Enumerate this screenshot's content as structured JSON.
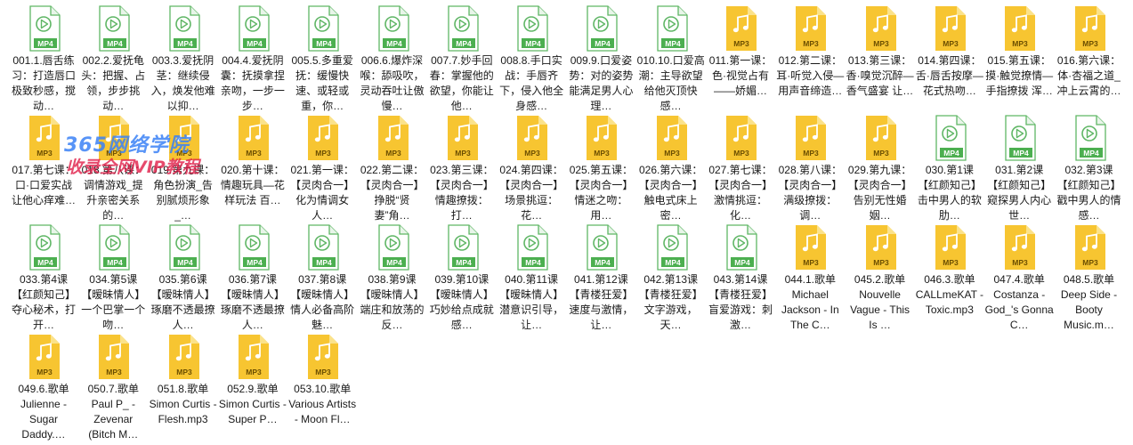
{
  "icons": {
    "mp4_label": "MP4",
    "mp3_label": "MP3",
    "mp4_color": "#4caf50",
    "mp3_color": "#f7c531"
  },
  "watermark": {
    "line1": "365网络学院",
    "line2": "收录全网VIP教程"
  },
  "files": [
    {
      "type": "mp4",
      "name": "001.1.唇舌练习：打造唇口极致秒感，搅动…"
    },
    {
      "type": "mp4",
      "name": "002.2.爱抚龟头：把握、占领，步步挑动…"
    },
    {
      "type": "mp4",
      "name": "003.3.爱抚阴茎：继续侵入，焕发他难以抑…"
    },
    {
      "type": "mp4",
      "name": "004.4.爱抚阴囊：抚摸拿捏亲吻，一步一步…"
    },
    {
      "type": "mp4",
      "name": "005.5.多重爱抚：缓慢快速、或轻或重，你…"
    },
    {
      "type": "mp4",
      "name": "006.6.爆炸深喉：舔吸吹，灵动吞吐让傲慢…"
    },
    {
      "type": "mp4",
      "name": "007.7.妙手回春：掌握他的欲望，你能让他…"
    },
    {
      "type": "mp4",
      "name": "008.8.手口实战：手唇齐下，侵入他全身感…"
    },
    {
      "type": "mp4",
      "name": "009.9.口爱姿势：对的姿势能满足男人心理…"
    },
    {
      "type": "mp4",
      "name": "010.10.口爱高潮：主导欲望给他灭顶快感…"
    },
    {
      "type": "mp3",
      "name": "011.第一课：色·视觉占有——娇媚…"
    },
    {
      "type": "mp3",
      "name": "012.第二课：耳·听觉入侵—用声音缔造…"
    },
    {
      "type": "mp3",
      "name": "013.第三课：香·嗅觉沉醉—香气盛宴 让…"
    },
    {
      "type": "mp3",
      "name": "014.第四课：舌·唇舌按摩—花式热吻…"
    },
    {
      "type": "mp3",
      "name": "015.第五课：摸·触觉撩情—手指撩拨 浑…"
    },
    {
      "type": "mp3",
      "name": "016.第六课：体·杏福之道_冲上云霄的…"
    },
    {
      "type": "mp3",
      "name": "017.第七课：口·口爱实战 让他心痒难…"
    },
    {
      "type": "mp3",
      "name": "018.第八课：调情游戏_提升亲密关系的…"
    },
    {
      "type": "mp3",
      "name": "019.第九课：角色扮演_告别腻烦形象_…"
    },
    {
      "type": "mp3",
      "name": "020.第十课：情趣玩具—花样玩法 百…"
    },
    {
      "type": "mp3",
      "name": "021.第一课：【灵肉合一】化为情调女人…"
    },
    {
      "type": "mp3",
      "name": "022.第二课：【灵肉合一】挣脱“贤妻”角…"
    },
    {
      "type": "mp3",
      "name": "023.第三课：【灵肉合一】情趣撩拨：打…"
    },
    {
      "type": "mp3",
      "name": "024.第四课：【灵肉合一】场景挑逗：花…"
    },
    {
      "type": "mp3",
      "name": "025.第五课：【灵肉合一】情迷之吻：用…"
    },
    {
      "type": "mp3",
      "name": "026.第六课：【灵肉合一】触电式床上密…"
    },
    {
      "type": "mp3",
      "name": "027.第七课：【灵肉合一】激情挑逗：化…"
    },
    {
      "type": "mp3",
      "name": "028.第八课：【灵肉合一】满级撩拨：调…"
    },
    {
      "type": "mp3",
      "name": "029.第九课：【灵肉合一】告别无性婚姻…"
    },
    {
      "type": "mp4",
      "name": "030.第1课【红颜知己】击中男人的软肋…"
    },
    {
      "type": "mp4",
      "name": "031.第2课【红颜知己】窥探男人内心世…"
    },
    {
      "type": "mp4",
      "name": "032.第3课【红颜知己】戳中男人的情感…"
    },
    {
      "type": "mp4",
      "name": "033.第4课【红颜知己】夺心秘术，打开…"
    },
    {
      "type": "mp4",
      "name": "034.第5课【暧昧情人】一个巴掌一个吻…"
    },
    {
      "type": "mp4",
      "name": "035.第6课【暧昧情人】琢磨不透最撩人…"
    },
    {
      "type": "mp4",
      "name": "036.第7课【暧昧情人】琢磨不透最撩人…"
    },
    {
      "type": "mp4",
      "name": "037.第8课【暧昧情人】情人必备高阶魅…"
    },
    {
      "type": "mp4",
      "name": "038.第9课【暧昧情人】端庄和放荡的反…"
    },
    {
      "type": "mp4",
      "name": "039.第10课【暧昧情人】巧妙给点成就感…"
    },
    {
      "type": "mp4",
      "name": "040.第11课【暧昧情人】潜意识引导，让…"
    },
    {
      "type": "mp4",
      "name": "041.第12课【青楼狂爱】速度与激情，让…"
    },
    {
      "type": "mp4",
      "name": "042.第13课 【青楼狂爱】文字游戏，天…"
    },
    {
      "type": "mp4",
      "name": "043.第14课【青楼狂爱】盲爱游戏：刺激…"
    },
    {
      "type": "mp3",
      "name": "044.1.歌单 Michael Jackson - In The C…"
    },
    {
      "type": "mp3",
      "name": "045.2.歌单 Nouvelle Vague - This Is …"
    },
    {
      "type": "mp3",
      "name": "046.3.歌单 CALLmeKAT - Toxic.mp3"
    },
    {
      "type": "mp3",
      "name": "047.4.歌单 Costanza - God_'s Gonna C…"
    },
    {
      "type": "mp3",
      "name": "048.5.歌单 Deep Side - Booty Music.m…"
    },
    {
      "type": "mp3",
      "name": "049.6.歌单 Julienne - Sugar Daddy.…"
    },
    {
      "type": "mp3",
      "name": "050.7.歌单 Paul P_ - Zevenar (Bitch M…"
    },
    {
      "type": "mp3",
      "name": "051.8.歌单 Simon Curtis - Flesh.mp3"
    },
    {
      "type": "mp3",
      "name": "052.9.歌单 Simon Curtis - Super P…"
    },
    {
      "type": "mp3",
      "name": "053.10.歌单 Various Artists - Moon Fl…"
    }
  ]
}
